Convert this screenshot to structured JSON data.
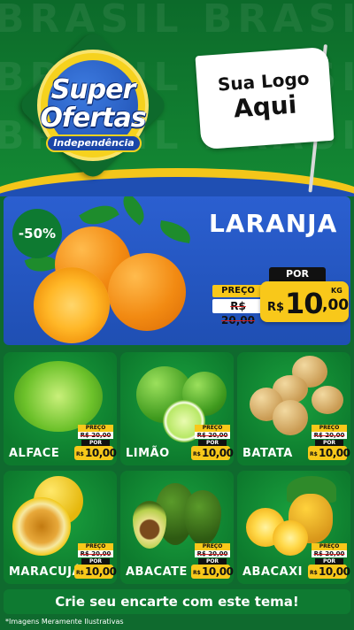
{
  "header": {
    "background_words": [
      "BRASIL BRASIL BRASIL",
      "BRASIL BRASIL BRASIL",
      "BRASIL BRASIL BRASIL"
    ],
    "logo": {
      "line1": "Super",
      "line2": "Ofertas",
      "ribbon": "Independência"
    },
    "flag": {
      "line1": "Sua Logo",
      "line2": "Aqui"
    }
  },
  "featured": {
    "discount": "-50%",
    "name": "LARANJA",
    "old_label": "PREÇO",
    "old_price": "R$ 20,00",
    "por_label": "POR",
    "currency": "R$",
    "price_int": "10",
    "price_dec": ",00",
    "unit": "KG"
  },
  "products": [
    {
      "name": "ALFACE",
      "preco": "PREÇO",
      "old": "R$ 20,00",
      "por": "POR",
      "cur": "R$",
      "price": "10,00"
    },
    {
      "name": "LIMÃO",
      "preco": "PREÇO",
      "old": "R$ 20,00",
      "por": "POR",
      "cur": "R$",
      "price": "10,00"
    },
    {
      "name": "BATATA",
      "preco": "PREÇO",
      "old": "R$ 20,00",
      "por": "POR",
      "cur": "R$",
      "price": "10,00"
    },
    {
      "name": "MARACUJÁ",
      "preco": "PREÇO",
      "old": "R$ 20,00",
      "por": "POR",
      "cur": "R$",
      "price": "10,00"
    },
    {
      "name": "ABACATE",
      "preco": "PREÇO",
      "old": "R$ 20,00",
      "por": "POR",
      "cur": "R$",
      "price": "10,00"
    },
    {
      "name": "ABACAXI",
      "preco": "PREÇO",
      "old": "R$ 20,00",
      "por": "POR",
      "cur": "R$",
      "price": "10,00"
    }
  ],
  "cta": "Crie seu encarte com este tema!",
  "disclaimer": "*Imagens Meramente Ilustrativas",
  "colors": {
    "green": "#0e7a31",
    "yellow": "#f8c81a",
    "blue": "#1f4fb3"
  }
}
